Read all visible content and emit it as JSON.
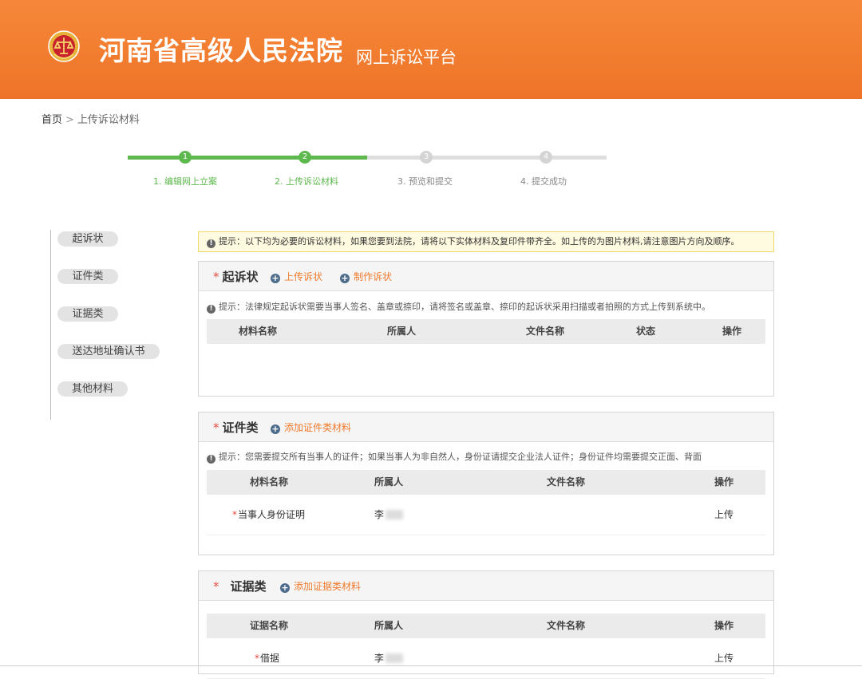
{
  "header": {
    "court_name": "河南省高级人民法院",
    "platform_name": "网上诉讼平台",
    "emblem_icon": "court-emblem-icon",
    "bg_color": "#f07a2d"
  },
  "breadcrumb": {
    "home": "首页",
    "separator": ">",
    "current": "上传诉讼材料"
  },
  "steps": [
    {
      "num": "1",
      "label": "1. 编辑网上立案",
      "state": "done"
    },
    {
      "num": "2",
      "label": "2. 上传诉讼材料",
      "state": "active"
    },
    {
      "num": "3",
      "label": "3. 预览和提交",
      "state": "pending"
    },
    {
      "num": "4",
      "label": "4. 提交成功",
      "state": "pending"
    }
  ],
  "sidebar": {
    "items": [
      "起诉状",
      "证件类",
      "证据类",
      "送达地址确认书",
      "其他材料"
    ]
  },
  "tip_banner": "提示：以下均为必要的诉讼材料，如果您要到法院，请将以下实体材料及复印件带齐全。如上传的为图片材料,请注意图片方向及顺序。",
  "panels": {
    "complaint": {
      "required": "*",
      "title": "起诉状",
      "action_upload": "上传诉状",
      "action_make": "制作诉状",
      "tip": "提示：法律规定起诉状需要当事人签名、盖章或捺印，请将签名或盖章、捺印的起诉状采用扫描或者拍照的方式上传到系统中。",
      "columns": [
        "材料名称",
        "所属人",
        "文件名称",
        "状态",
        "操作"
      ]
    },
    "id_docs": {
      "required": "*",
      "title": "证件类",
      "action_add": "添加证件类材料",
      "tip": "提示：您需要提交所有当事人的证件；如果当事人为非自然人，身份证请提交企业法人证件；身份证件均需要提交正面、背面",
      "columns": [
        "材料名称",
        "所属人",
        "文件名称",
        "操作"
      ],
      "rows": [
        {
          "required": "*",
          "name": "当事人身份证明",
          "owner": "李",
          "action": "上传"
        }
      ]
    },
    "evidence": {
      "required": "*",
      "title": "证据类",
      "action_add": "添加证据类材料",
      "columns": [
        "证据名称",
        "所属人",
        "文件名称",
        "操作"
      ],
      "rows": [
        {
          "required": "*",
          "name": "借据",
          "owner": "李",
          "action": "上传"
        }
      ]
    }
  },
  "colors": {
    "step_done": "#5db94d",
    "step_pending": "#d9d9d9",
    "accent": "#f07a2d",
    "required": "#e84c3d"
  }
}
